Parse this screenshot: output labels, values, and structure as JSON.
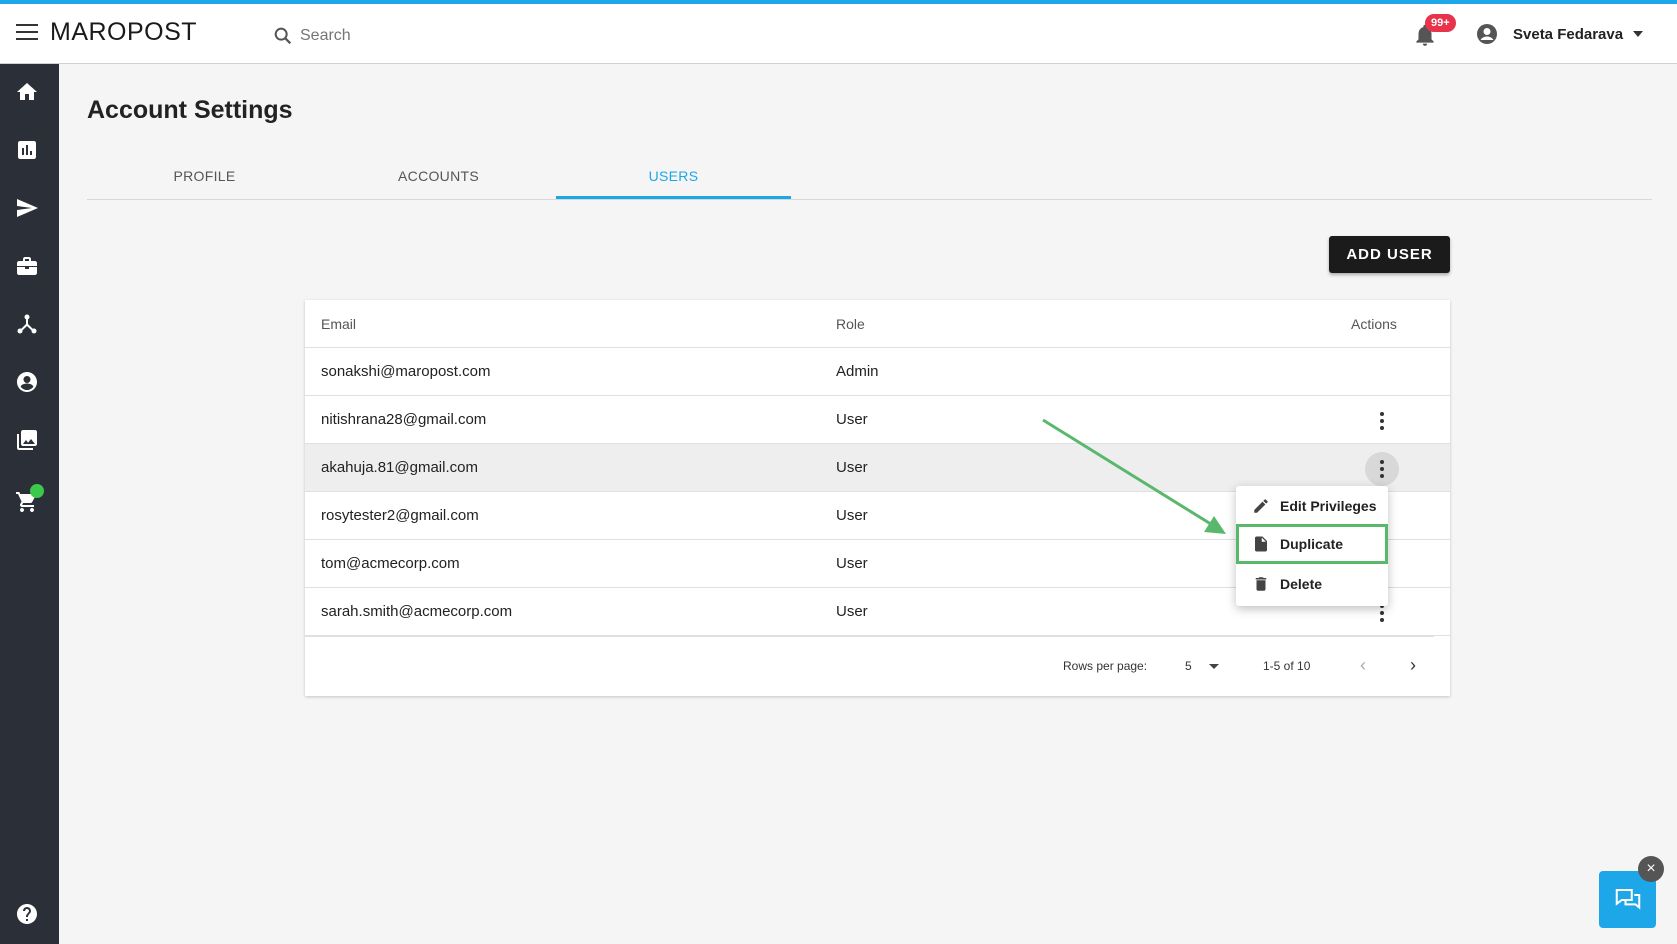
{
  "header": {
    "logo": "MAROPOST",
    "search_placeholder": "Search",
    "notification_badge": "99+",
    "user_name": "Sveta Fedarava"
  },
  "page": {
    "title": "Account Settings",
    "tabs": [
      {
        "label": "PROFILE"
      },
      {
        "label": "ACCOUNTS"
      },
      {
        "label": "USERS"
      }
    ],
    "active_tab": "USERS",
    "add_user_label": "ADD USER"
  },
  "table": {
    "columns": [
      "Email",
      "Role",
      "Actions"
    ],
    "rows": [
      {
        "email": "sonakshi@maropost.com",
        "role": "Admin"
      },
      {
        "email": "nitishrana28@gmail.com",
        "role": "User"
      },
      {
        "email": "akahuja.81@gmail.com",
        "role": "User"
      },
      {
        "email": "rosytester2@gmail.com",
        "role": "User"
      },
      {
        "email": "tom@acmecorp.com",
        "role": "User"
      },
      {
        "email": "sarah.smith@acmecorp.com",
        "role": "User"
      }
    ],
    "footer": {
      "rows_per_page_label": "Rows per page:",
      "rows_per_page_value": "5",
      "range": "1-5 of 10"
    }
  },
  "context_menu": {
    "items": [
      {
        "label": "Edit Privileges",
        "icon": "pencil-icon"
      },
      {
        "label": "Duplicate",
        "icon": "document-icon"
      },
      {
        "label": "Delete",
        "icon": "trash-icon"
      }
    ]
  },
  "sidebar": {
    "icons": [
      "home-icon",
      "bar-chart-icon",
      "send-icon",
      "briefcase-icon",
      "network-icon",
      "account-circle-icon",
      "image-gallery-icon",
      "cart-icon",
      "help-icon"
    ]
  },
  "colors": {
    "accent": "#1ea7e8",
    "sidebar_bg": "#2b2f38",
    "highlight_green": "#5ab86c",
    "badge_red": "#e8334a"
  }
}
